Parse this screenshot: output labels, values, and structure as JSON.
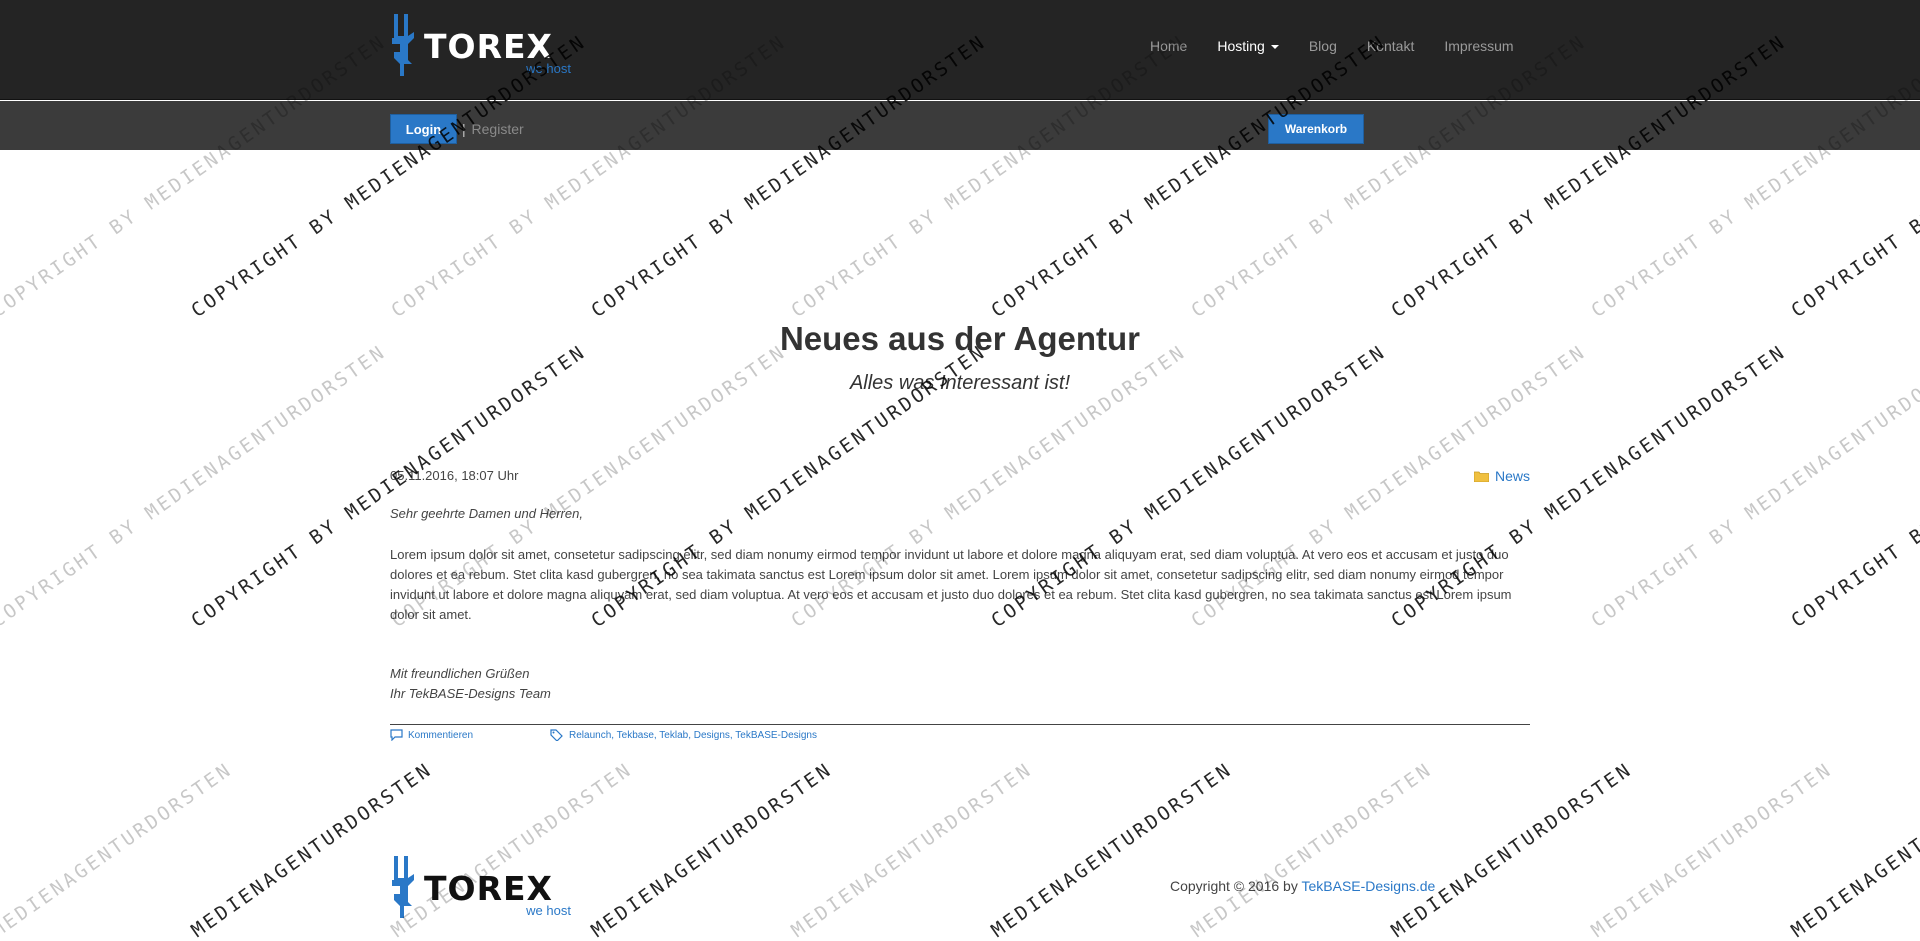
{
  "brand": {
    "name": "TOREX",
    "tagline": "we host",
    "color": "#2a78c7"
  },
  "nav": {
    "items": [
      {
        "label": "Home",
        "active": false
      },
      {
        "label": "Hosting",
        "active": true,
        "dropdown": true
      },
      {
        "label": "Blog",
        "active": false
      },
      {
        "label": "Kontakt",
        "active": false
      },
      {
        "label": "Impressum",
        "active": false
      }
    ]
  },
  "account": {
    "login_label": "Login",
    "separator": "|",
    "register_label": "Register",
    "cart_label": "Warenkorb"
  },
  "page": {
    "title": "Neues aus der Agentur",
    "subtitle": "Alles was Interessant ist!"
  },
  "post": {
    "date": "05.11.2016, 18:07 Uhr",
    "category": "News",
    "greeting": "Sehr geehrte Damen und Herren,",
    "body": "Lorem ipsum dolor sit amet, consetetur sadipscing elitr, sed diam nonumy eirmod tempor invidunt ut labore et dolore magna aliquyam erat, sed diam voluptua. At vero eos et accusam et justo duo dolores et ea rebum. Stet clita kasd gubergren, no sea takimata sanctus est Lorem ipsum dolor sit amet. Lorem ipsum dolor sit amet, consetetur sadipscing elitr, sed diam nonumy eirmod tempor invidunt ut labore et dolore magna aliquyam erat, sed diam voluptua. At vero eos et accusam et justo duo dolores et ea rebum. Stet clita kasd gubergren, no sea takimata sanctus est Lorem ipsum dolor sit amet.",
    "closing": "Mit freundlichen Grüßen",
    "signature": "Ihr TekBASE-Designs Team",
    "comments_label": "Kommentieren",
    "tags": [
      "Relaunch",
      "Tekbase",
      "Teklab",
      "Designs",
      "TekBASE-Designs"
    ]
  },
  "footer": {
    "copyright_prefix": "Copyright © 2016 by",
    "copyright_link": "TekBASE-Designs.de"
  },
  "watermark": {
    "text_a": "COPYRIGHT BY MEDIENAGENTURDORSTEN",
    "text_b": "MEDIENAGENTURDORSTEN"
  }
}
